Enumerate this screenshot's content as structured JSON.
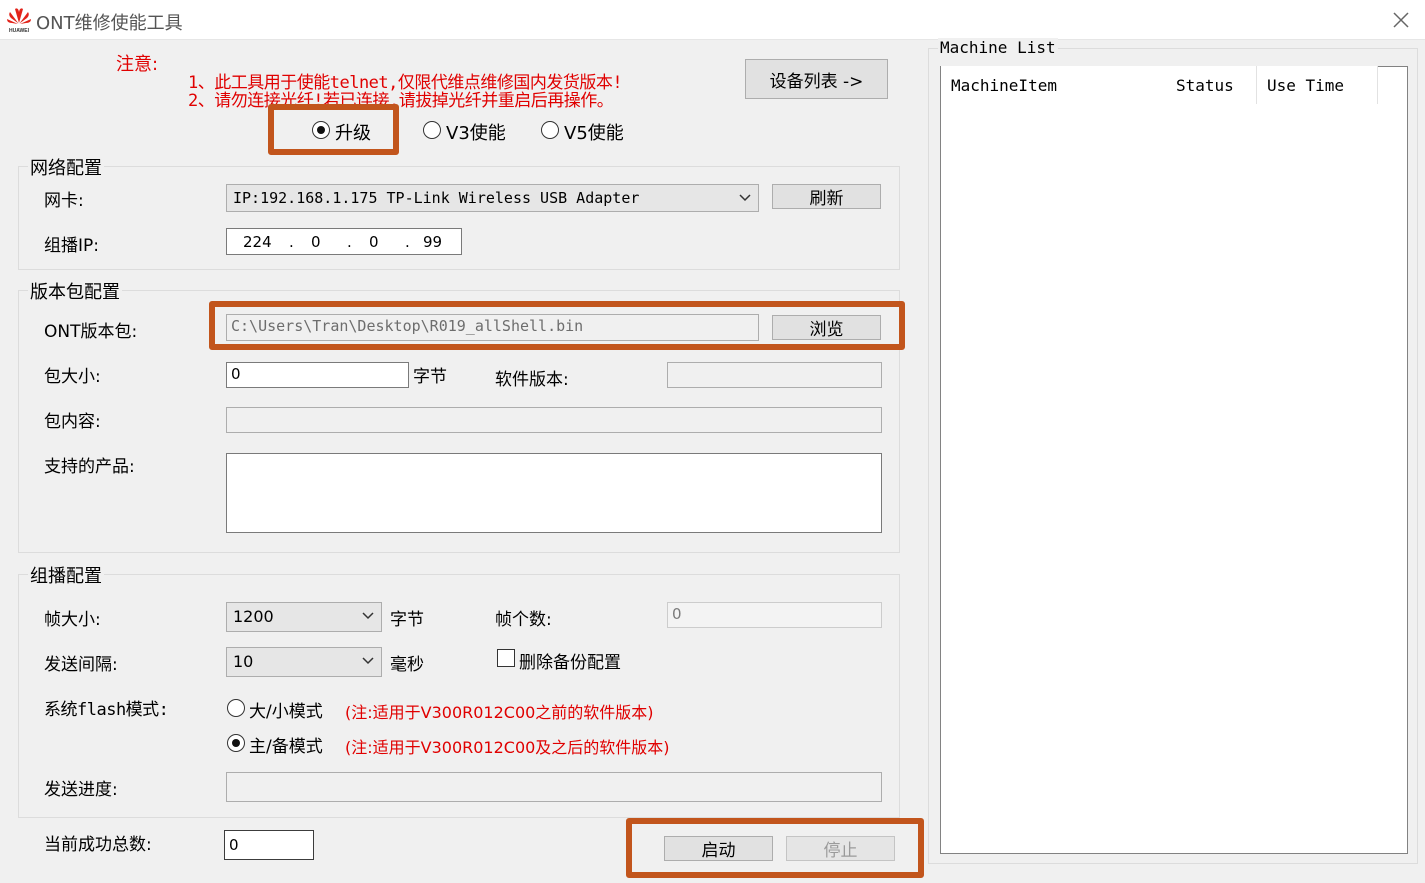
{
  "window": {
    "title": "ONT维修使能工具",
    "logo_icon": "huawei-logo",
    "logo_text": "HUAWEI",
    "brand_color": "#e2231a"
  },
  "notice": {
    "label": "注意:",
    "line1": "1、此工具用于使能telnet,仅限代维点维修国内发货版本!",
    "line2": "2、请勿连接光纤!若已连接,请拔掉光纤并重启后再操作。"
  },
  "device_list_button": "设备列表 ->",
  "modes": {
    "upgrade": "升级",
    "v3": "V3使能",
    "v5": "V5使能",
    "selected": "升级"
  },
  "network": {
    "group_title": "网络配置",
    "nic_label": "网卡:",
    "nic_value": "IP:192.168.1.175 TP-Link Wireless USB Adapter",
    "refresh_button": "刷新",
    "multicast_ip_label": "组播IP:",
    "ip_octets": [
      "224",
      "0",
      "0",
      "99"
    ]
  },
  "package": {
    "group_title": "版本包配置",
    "ont_package_label": "ONT版本包:",
    "ont_package_path": "C:\\Users\\Tran\\Desktop\\R019_allShell.bin",
    "browse_button": "浏览",
    "size_label": "包大小:",
    "size_value": "0",
    "size_unit": "字节",
    "software_version_label": "软件版本:",
    "software_version_value": "",
    "content_label": "包内容:",
    "content_value": "",
    "supported_products_label": "支持的产品:",
    "supported_products_value": ""
  },
  "multicast": {
    "group_title": "组播配置",
    "frame_size_label": "帧大小:",
    "frame_size_value": "1200",
    "frame_size_unit": "字节",
    "frame_count_label": "帧个数:",
    "frame_count_value": "0",
    "interval_label": "发送间隔:",
    "interval_value": "10",
    "interval_unit": "毫秒",
    "delete_backup_label": "删除备份配置",
    "flash_mode_label": "系统flash模式:",
    "flash_mode_big_small": "大/小模式",
    "flash_mode_big_small_note": "(注:适用于V300R012C00之前的软件版本)",
    "flash_mode_main_backup": "主/备模式",
    "flash_mode_main_backup_note": "(注:适用于V300R012C00及之后的软件版本)",
    "flash_mode_selected": "主/备模式",
    "progress_label": "发送进度:",
    "progress_fraction": 0
  },
  "success_total": {
    "label": "当前成功总数:",
    "value": "0"
  },
  "actions": {
    "start_button": "启动",
    "stop_button": "停止"
  },
  "machine_list": {
    "title": "Machine List",
    "columns": [
      "MachineItem",
      "Status",
      "Use Time"
    ]
  },
  "colors": {
    "highlight": "#c2551c",
    "notice_red": "#e00000"
  }
}
